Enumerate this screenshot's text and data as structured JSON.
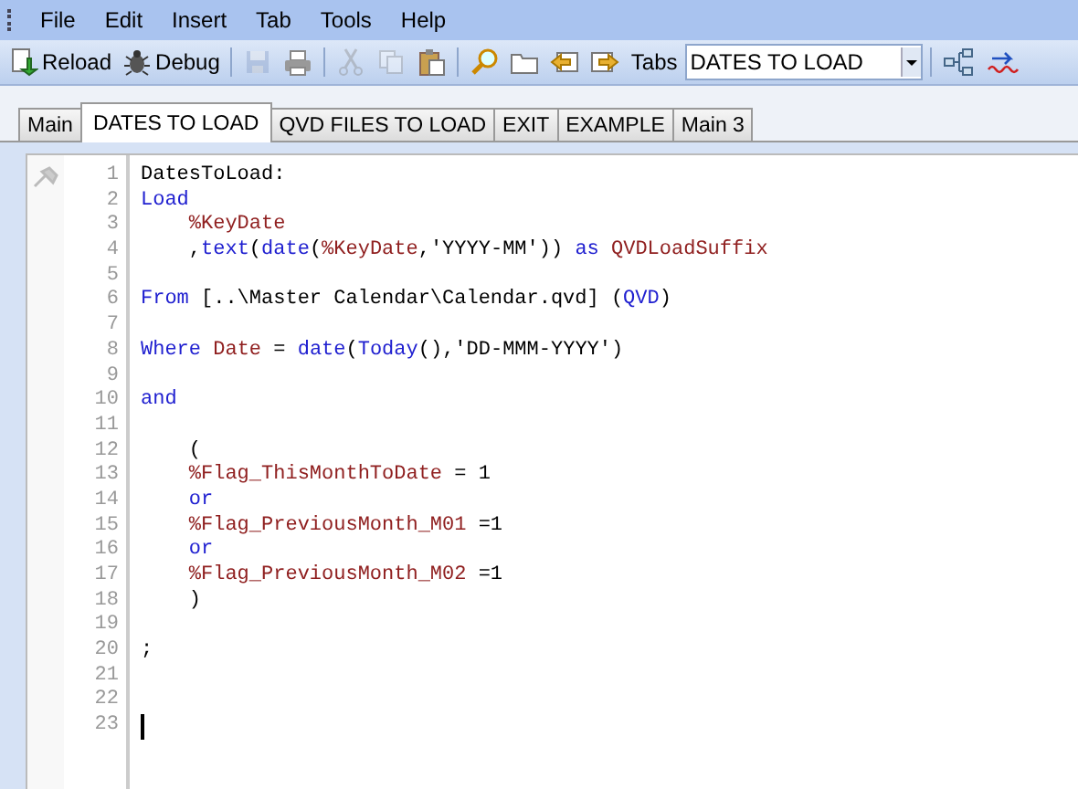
{
  "menu": [
    {
      "label": "File"
    },
    {
      "label": "Edit"
    },
    {
      "label": "Insert"
    },
    {
      "label": "Tab"
    },
    {
      "label": "Tools"
    },
    {
      "label": "Help"
    }
  ],
  "toolbar": [
    {
      "kind": "reload",
      "label": "Reload",
      "disabled": false
    },
    {
      "kind": "debug",
      "label": "Debug",
      "disabled": false
    },
    {
      "kind": "save",
      "disabled": true
    },
    {
      "kind": "print",
      "disabled": false
    },
    {
      "kind": "cut",
      "disabled": true
    },
    {
      "kind": "copy",
      "disabled": true
    },
    {
      "kind": "paste",
      "disabled": false
    },
    {
      "kind": "find",
      "disabled": false
    },
    {
      "kind": "folder",
      "disabled": false
    },
    {
      "kind": "tab-left",
      "disabled": false
    },
    {
      "kind": "tab-right",
      "disabled": false
    }
  ],
  "tabs_label": "Tabs",
  "tab_dropdown": {
    "value": "DATES TO LOAD"
  },
  "toolbar_end": [
    {
      "kind": "tree"
    },
    {
      "kind": "wave"
    }
  ],
  "tabs": [
    {
      "label": "Main",
      "selected": false
    },
    {
      "label": "DATES TO LOAD",
      "selected": true
    },
    {
      "label": "QVD FILES TO LOAD",
      "selected": false
    },
    {
      "label": "EXIT",
      "selected": false
    },
    {
      "label": "EXAMPLE",
      "selected": false
    },
    {
      "label": "Main 3",
      "selected": false
    }
  ],
  "lines": [
    {
      "number": "1",
      "cursor": false,
      "tokens": [
        {
          "kind": "plain",
          "text": "DatesToLoad:"
        }
      ]
    },
    {
      "number": "2",
      "cursor": false,
      "tokens": [
        {
          "kind": "keyword",
          "text": "Load"
        }
      ]
    },
    {
      "number": "3",
      "cursor": false,
      "tokens": [
        {
          "kind": "field",
          "text": "    %KeyDate"
        }
      ]
    },
    {
      "number": "4",
      "cursor": false,
      "tokens": [
        {
          "kind": "plain",
          "text": "    ,"
        },
        {
          "kind": "keyword",
          "text": "text"
        },
        {
          "kind": "plain",
          "text": "("
        },
        {
          "kind": "keyword",
          "text": "date"
        },
        {
          "kind": "plain",
          "text": "("
        },
        {
          "kind": "field",
          "text": "%KeyDate"
        },
        {
          "kind": "plain",
          "text": ",'YYYY-MM')) "
        },
        {
          "kind": "keyword",
          "text": "as"
        },
        {
          "kind": "field",
          "text": " QVDLoadSuffix"
        }
      ]
    },
    {
      "number": "5",
      "cursor": false
    },
    {
      "number": "6",
      "cursor": false,
      "tokens": [
        {
          "kind": "keyword",
          "text": "From"
        },
        {
          "kind": "plain",
          "text": " [..\\Master Calendar\\Calendar.qvd] ("
        },
        {
          "kind": "keyword",
          "text": "QVD"
        },
        {
          "kind": "plain",
          "text": ")"
        }
      ]
    },
    {
      "number": "7",
      "cursor": false
    },
    {
      "number": "8",
      "cursor": false,
      "tokens": [
        {
          "kind": "keyword",
          "text": "Where"
        },
        {
          "kind": "field",
          "text": " Date"
        },
        {
          "kind": "plain",
          "text": " = "
        },
        {
          "kind": "keyword",
          "text": "date"
        },
        {
          "kind": "plain",
          "text": "("
        },
        {
          "kind": "keyword",
          "text": "Today"
        },
        {
          "kind": "plain",
          "text": "(),'DD-MMM-YYYY')"
        }
      ]
    },
    {
      "number": "9",
      "cursor": false
    },
    {
      "number": "10",
      "cursor": false,
      "tokens": [
        {
          "kind": "keyword",
          "text": "and"
        }
      ]
    },
    {
      "number": "11",
      "cursor": false
    },
    {
      "number": "12",
      "cursor": false,
      "tokens": [
        {
          "kind": "plain",
          "text": "    ("
        }
      ]
    },
    {
      "number": "13",
      "cursor": false,
      "tokens": [
        {
          "kind": "field",
          "text": "    %Flag_ThisMonthToDate"
        },
        {
          "kind": "plain",
          "text": " = 1"
        }
      ]
    },
    {
      "number": "14",
      "cursor": false,
      "tokens": [
        {
          "kind": "keyword",
          "text": "    or"
        }
      ]
    },
    {
      "number": "15",
      "cursor": false,
      "tokens": [
        {
          "kind": "field",
          "text": "    %Flag_PreviousMonth_M01"
        },
        {
          "kind": "plain",
          "text": " =1"
        }
      ]
    },
    {
      "number": "16",
      "cursor": false,
      "tokens": [
        {
          "kind": "keyword",
          "text": "    or"
        }
      ]
    },
    {
      "number": "17",
      "cursor": false,
      "tokens": [
        {
          "kind": "field",
          "text": "    %Flag_PreviousMonth_M02"
        },
        {
          "kind": "plain",
          "text": " =1"
        }
      ]
    },
    {
      "number": "18",
      "cursor": false,
      "tokens": [
        {
          "kind": "plain",
          "text": "    )"
        }
      ]
    },
    {
      "number": "19",
      "cursor": false
    },
    {
      "number": "20",
      "cursor": false,
      "tokens": [
        {
          "kind": "plain",
          "text": ";"
        }
      ]
    },
    {
      "number": "21",
      "cursor": false
    },
    {
      "number": "22",
      "cursor": false
    },
    {
      "number": "23",
      "cursor": true
    }
  ]
}
